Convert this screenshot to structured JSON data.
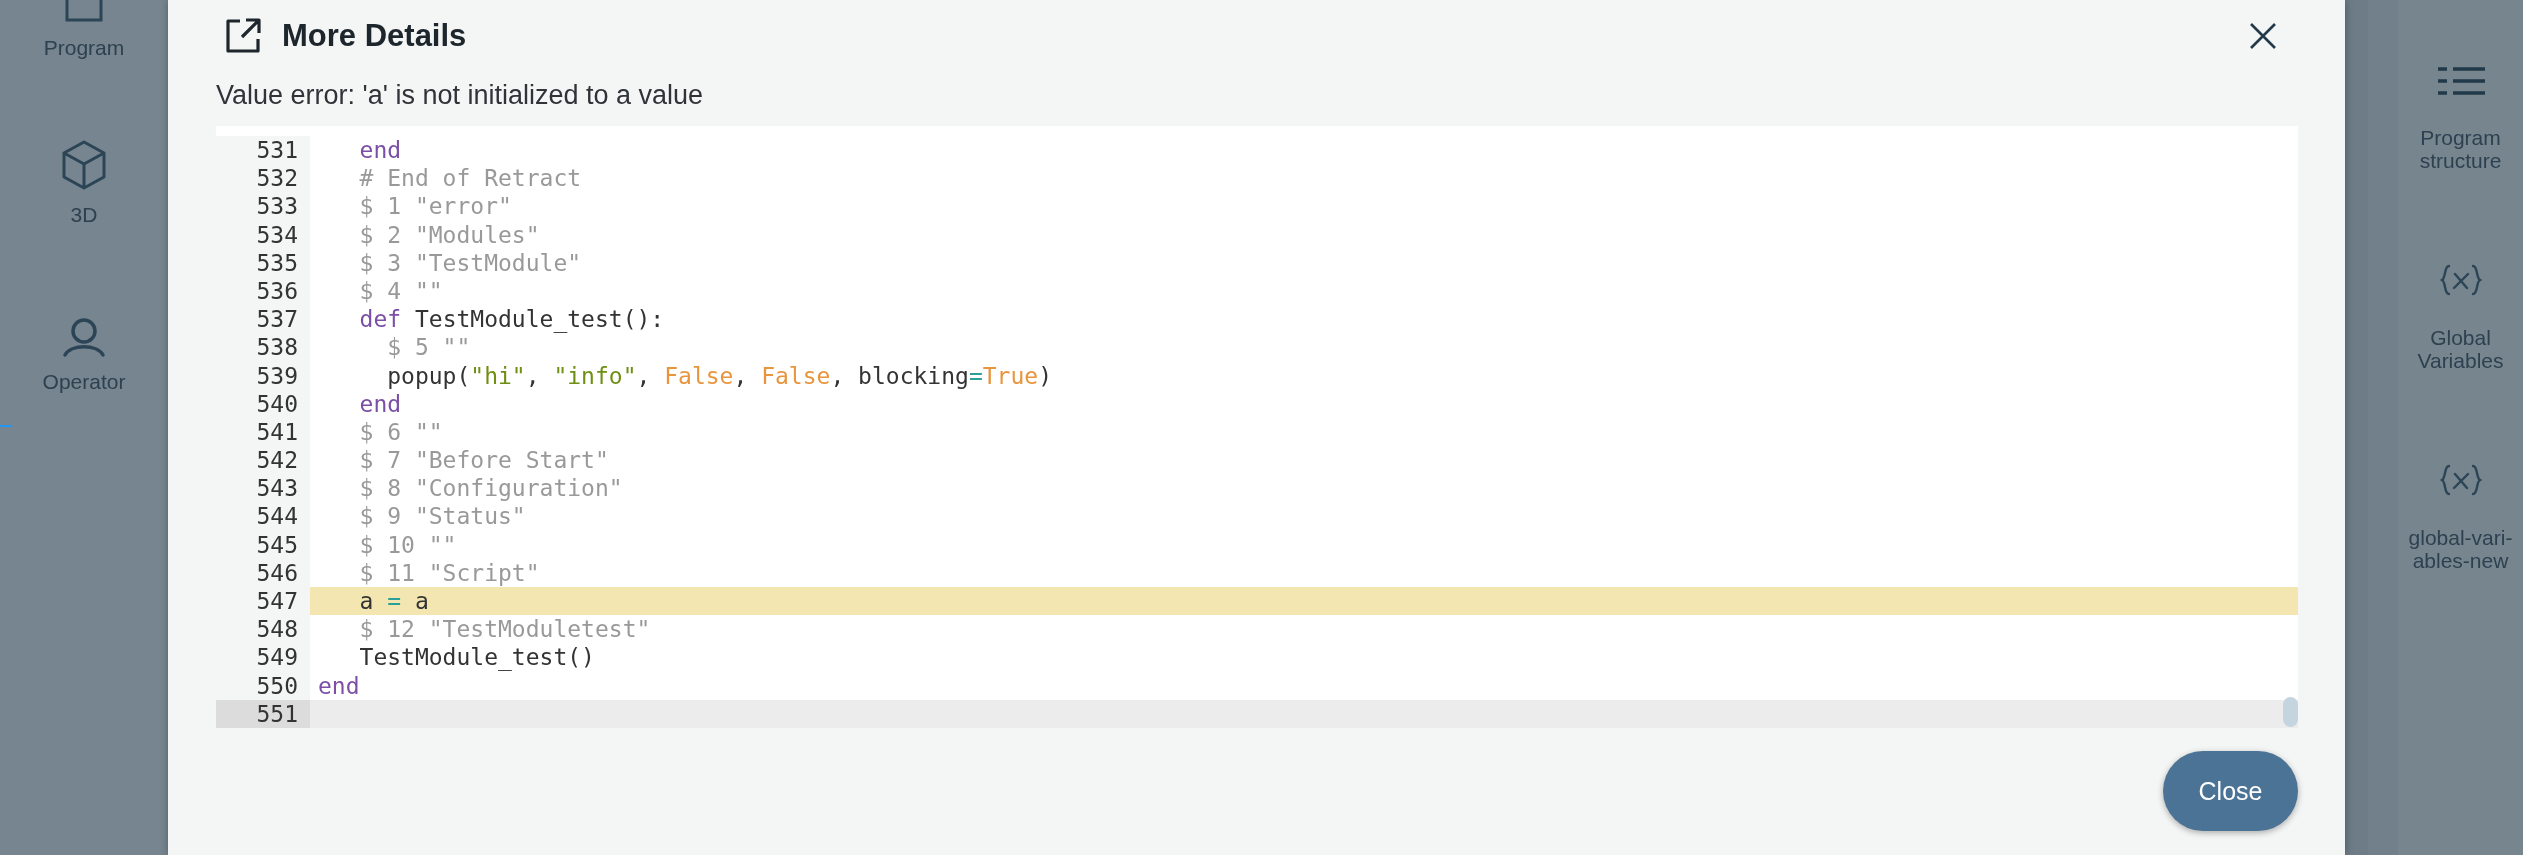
{
  "left_nav": {
    "items": [
      {
        "label": "Program"
      },
      {
        "label": "3D"
      },
      {
        "label": "Operator"
      }
    ]
  },
  "dialog": {
    "title": "More Details",
    "message": "Value error: 'a' is not initialized to a value",
    "code": {
      "lines": [
        {
          "number": "531",
          "highlighted": false,
          "active": false,
          "tokens": [
            {
              "kind": "keyword",
              "text": "   end"
            }
          ]
        },
        {
          "number": "532",
          "highlighted": false,
          "active": false,
          "tokens": [
            {
              "kind": "comment",
              "text": "   # End of Retract"
            }
          ]
        },
        {
          "number": "533",
          "highlighted": false,
          "active": false,
          "tokens": [
            {
              "kind": "comment",
              "text": "   $ 1 \"error\""
            }
          ]
        },
        {
          "number": "534",
          "highlighted": false,
          "active": false,
          "tokens": [
            {
              "kind": "comment",
              "text": "   $ 2 \"Modules\""
            }
          ]
        },
        {
          "number": "535",
          "highlighted": false,
          "active": false,
          "tokens": [
            {
              "kind": "comment",
              "text": "   $ 3 \"TestModule\""
            }
          ]
        },
        {
          "number": "536",
          "highlighted": false,
          "active": false,
          "tokens": [
            {
              "kind": "comment",
              "text": "   $ 4 \"\""
            }
          ]
        },
        {
          "number": "537",
          "highlighted": false,
          "active": false,
          "tokens": [
            {
              "kind": "keyword",
              "text": "   def"
            },
            {
              "kind": "plain",
              "text": " TestModule_test():"
            }
          ]
        },
        {
          "number": "538",
          "highlighted": false,
          "active": false,
          "tokens": [
            {
              "kind": "comment",
              "text": "     $ 5 \"\""
            }
          ]
        },
        {
          "number": "539",
          "highlighted": false,
          "active": false,
          "tokens": [
            {
              "kind": "plain",
              "text": "     popup("
            },
            {
              "kind": "string",
              "text": "\"hi\""
            },
            {
              "kind": "plain",
              "text": ", "
            },
            {
              "kind": "string",
              "text": "\"info\""
            },
            {
              "kind": "plain",
              "text": ", "
            },
            {
              "kind": "number",
              "text": "False"
            },
            {
              "kind": "plain",
              "text": ", "
            },
            {
              "kind": "number",
              "text": "False"
            },
            {
              "kind": "plain",
              "text": ", blocking"
            },
            {
              "kind": "operator",
              "text": "="
            },
            {
              "kind": "number",
              "text": "True"
            },
            {
              "kind": "plain",
              "text": ")"
            }
          ]
        },
        {
          "number": "540",
          "highlighted": false,
          "active": false,
          "tokens": [
            {
              "kind": "keyword",
              "text": "   end"
            }
          ]
        },
        {
          "number": "541",
          "highlighted": false,
          "active": false,
          "tokens": [
            {
              "kind": "comment",
              "text": "   $ 6 \"\""
            }
          ]
        },
        {
          "number": "542",
          "highlighted": false,
          "active": false,
          "tokens": [
            {
              "kind": "comment",
              "text": "   $ 7 \"Before Start\""
            }
          ]
        },
        {
          "number": "543",
          "highlighted": false,
          "active": false,
          "tokens": [
            {
              "kind": "comment",
              "text": "   $ 8 \"Configuration\""
            }
          ]
        },
        {
          "number": "544",
          "highlighted": false,
          "active": false,
          "tokens": [
            {
              "kind": "comment",
              "text": "   $ 9 \"Status\""
            }
          ]
        },
        {
          "number": "545",
          "highlighted": false,
          "active": false,
          "tokens": [
            {
              "kind": "comment",
              "text": "   $ 10 \"\""
            }
          ]
        },
        {
          "number": "546",
          "highlighted": false,
          "active": false,
          "tokens": [
            {
              "kind": "comment",
              "text": "   $ 11 \"Script\""
            }
          ]
        },
        {
          "number": "547",
          "highlighted": true,
          "active": false,
          "tokens": [
            {
              "kind": "plain",
              "text": "   a "
            },
            {
              "kind": "operator",
              "text": "="
            },
            {
              "kind": "plain",
              "text": " a"
            }
          ]
        },
        {
          "number": "548",
          "highlighted": false,
          "active": false,
          "tokens": [
            {
              "kind": "comment",
              "text": "   $ 12 \"TestModuletest\""
            }
          ]
        },
        {
          "number": "549",
          "highlighted": false,
          "active": false,
          "tokens": [
            {
              "kind": "plain",
              "text": "   TestModule_test()"
            }
          ]
        },
        {
          "number": "550",
          "highlighted": false,
          "active": false,
          "tokens": [
            {
              "kind": "keyword",
              "text": "end"
            }
          ]
        },
        {
          "number": "551",
          "highlighted": false,
          "active": true
        }
      ]
    },
    "close_button": "Close"
  },
  "right_nav": {
    "items": [
      {
        "label": "Program structure"
      },
      {
        "label": "Global Variables"
      },
      {
        "label": "global-vari-ables-new"
      }
    ]
  }
}
